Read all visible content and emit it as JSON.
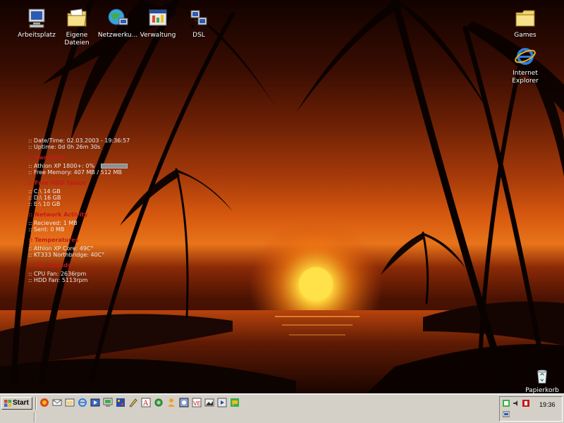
{
  "desktop_icons": {
    "arbeitsplatz": "Arbeitsplatz",
    "eigene_dateien_line1": "Eigene",
    "eigene_dateien_line2": "Dateien",
    "netzwerk": "Netzwerku...",
    "verwaltung": "Verwaltung",
    "dsl": "DSL",
    "games": "Games",
    "ie_line1": "Internet",
    "ie_line2": "Explorer",
    "recycle_bin": "Papierkorb"
  },
  "sysmon": {
    "datetime": ":: Date/Time: 02.03.2003 - 19:36:57",
    "uptime": ":: Uptime: 0d 0h 26m 30s",
    "hardware_head": ":: Hardware",
    "cpu": ":: Athlon XP 1800+: 0%",
    "cpu_load_percent": 0,
    "memory": ":: Free Memory: 407 MB / 512 MB",
    "hdd_head": ":: Free HDD Space",
    "drive_c": ":: C:\\ 14 GB",
    "drive_d": ":: D:\\ 16 GB",
    "drive_e": ":: E:\\ 10 GB",
    "network_head": ":: Network Activity",
    "received": ":: Recieved: 1 MB",
    "sent": ":: Sent: 0 MB",
    "temp_head": ":: Temperatures",
    "cpu_temp": ":: Athlon XP Core: 49C°",
    "nb_temp": ":: KT333 Northbridge: 40C°",
    "fan_head": ":: Fan Speeds",
    "cpu_fan": ":: CPU Fan: 2636rpm",
    "hdd_fan": ":: HDD Fan: 5113rpm"
  },
  "taskbar": {
    "start_label": "Start",
    "clock": "19:36",
    "quicklaunch_icons": [
      "browser-icon",
      "mail-icon",
      "explorer-icon",
      "ie-icon",
      "media-icon",
      "monitor-icon",
      "network-icon",
      "paint-icon",
      "font-icon",
      "gear-icon",
      "user-icon",
      "app-icon",
      "ve-icon",
      "photo-icon",
      "player-icon",
      "chat-icon"
    ],
    "tray_icons": [
      "network-tray-icon",
      "volume-tray-icon",
      "security-tray-icon",
      "display-tray-icon"
    ]
  },
  "colors": {
    "section_head": "#c41a1a",
    "taskbar_bg": "#d4d0c8",
    "monitor_text": "#e8e8e8"
  }
}
